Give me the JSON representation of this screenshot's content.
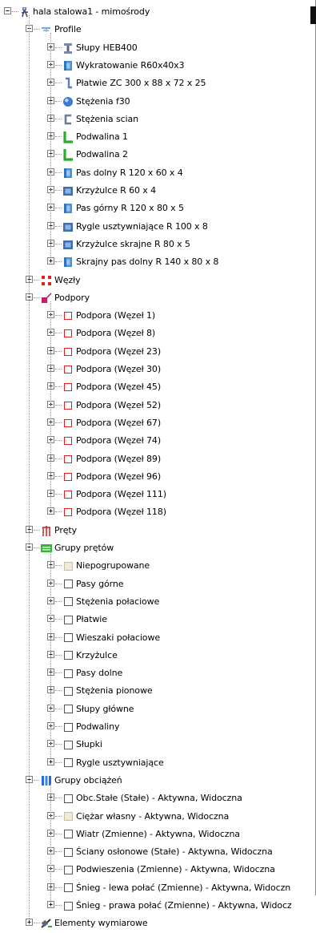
{
  "colors": {
    "accent": "#2a6bd6",
    "support": "#e02020",
    "group": "#2fb52f",
    "tree_line": "#9a9a9a"
  },
  "tree": [
    {
      "level": 0,
      "expander": "minus",
      "icon": "robot-icon",
      "label": "hala stalowa1 - mimośrody",
      "name": "tree-root"
    },
    {
      "level": 1,
      "expander": "minus",
      "icon": "profile-folder-icon",
      "label": "Profile",
      "name": "tree-item-profile"
    },
    {
      "level": 2,
      "expander": "plus",
      "icon": "i-beam-icon",
      "label": "Słupy HEB400",
      "name": "profile-item"
    },
    {
      "level": 2,
      "expander": "plus",
      "icon": "rect-tube-icon",
      "label": "Wykratowanie R60x40x3",
      "name": "profile-item"
    },
    {
      "level": 2,
      "expander": "plus",
      "icon": "z-section-icon",
      "label": "Płatwie ZC 300 x 88 x 72 x 25",
      "name": "profile-item"
    },
    {
      "level": 2,
      "expander": "plus",
      "icon": "round-bar-icon",
      "label": "Stężenia f30",
      "name": "profile-item"
    },
    {
      "level": 2,
      "expander": "plus",
      "icon": "c-section-icon",
      "label": "Stężenia scian",
      "name": "profile-item"
    },
    {
      "level": 2,
      "expander": "plus",
      "icon": "l-section-icon",
      "label": "Podwalina 1",
      "name": "profile-item"
    },
    {
      "level": 2,
      "expander": "plus",
      "icon": "l-section-icon",
      "label": "Podwalina 2",
      "name": "profile-item"
    },
    {
      "level": 2,
      "expander": "plus",
      "icon": "rect-tube-icon",
      "label": "Pas dolny R 120 x 60 x 4",
      "name": "profile-item"
    },
    {
      "level": 2,
      "expander": "plus",
      "icon": "square-tube-icon",
      "label": "Krzyżulce R 60 x 4",
      "name": "profile-item"
    },
    {
      "level": 2,
      "expander": "plus",
      "icon": "rect-tube-icon",
      "label": "Pas górny R 120 x 80 x 5",
      "name": "profile-item"
    },
    {
      "level": 2,
      "expander": "plus",
      "icon": "square-tube-icon",
      "label": "Rygle usztywniające R 100 x 8",
      "name": "profile-item"
    },
    {
      "level": 2,
      "expander": "plus",
      "icon": "square-tube-icon",
      "label": "Krzyżulce skrajne R 80 x 5",
      "name": "profile-item"
    },
    {
      "level": 2,
      "expander": "plus",
      "icon": "rect-tube-icon",
      "label": "Skrajny pas dolny R 140 x 80 x 8",
      "name": "profile-item"
    },
    {
      "level": 1,
      "expander": "plus",
      "icon": "nodes-icon",
      "label": "Węzły",
      "name": "tree-item-nodes"
    },
    {
      "level": 1,
      "expander": "minus",
      "icon": "support-icon",
      "label": "Podpory",
      "name": "tree-item-supports"
    },
    {
      "level": 2,
      "expander": "plus",
      "icon": "red-square-icon",
      "label": "Podpora (Węzeł 1)",
      "name": "support-item"
    },
    {
      "level": 2,
      "expander": "plus",
      "icon": "red-square-icon",
      "label": "Podpora (Węzeł 8)",
      "name": "support-item"
    },
    {
      "level": 2,
      "expander": "plus",
      "icon": "red-square-icon",
      "label": "Podpora (Węzeł 23)",
      "name": "support-item"
    },
    {
      "level": 2,
      "expander": "plus",
      "icon": "red-square-icon",
      "label": "Podpora (Węzeł 30)",
      "name": "support-item"
    },
    {
      "level": 2,
      "expander": "plus",
      "icon": "red-square-icon",
      "label": "Podpora (Węzeł 45)",
      "name": "support-item"
    },
    {
      "level": 2,
      "expander": "plus",
      "icon": "red-square-icon",
      "label": "Podpora (Węzeł 52)",
      "name": "support-item"
    },
    {
      "level": 2,
      "expander": "plus",
      "icon": "red-square-icon",
      "label": "Podpora (Węzeł 67)",
      "name": "support-item"
    },
    {
      "level": 2,
      "expander": "plus",
      "icon": "red-square-icon",
      "label": "Podpora (Węzeł 74)",
      "name": "support-item"
    },
    {
      "level": 2,
      "expander": "plus",
      "icon": "red-square-icon",
      "label": "Podpora (Węzeł 89)",
      "name": "support-item"
    },
    {
      "level": 2,
      "expander": "plus",
      "icon": "red-square-icon",
      "label": "Podpora (Węzeł 96)",
      "name": "support-item"
    },
    {
      "level": 2,
      "expander": "plus",
      "icon": "red-square-icon",
      "label": "Podpora (Węzeł 111)",
      "name": "support-item"
    },
    {
      "level": 2,
      "expander": "plus",
      "icon": "red-square-icon",
      "label": "Podpora (Węzeł 118)",
      "name": "support-item"
    },
    {
      "level": 1,
      "expander": "plus",
      "icon": "bars-icon",
      "label": "Pręty",
      "name": "tree-item-bars"
    },
    {
      "level": 1,
      "expander": "minus",
      "icon": "bar-groups-icon",
      "label": "Grupy prętów",
      "name": "tree-item-bar-groups"
    },
    {
      "level": 2,
      "expander": "plus",
      "icon": "beige-square-icon",
      "label": "Niepogrupowane",
      "name": "bar-group-item"
    },
    {
      "level": 2,
      "expander": "plus",
      "icon": "empty-square-icon",
      "label": "Pasy górne",
      "name": "bar-group-item"
    },
    {
      "level": 2,
      "expander": "plus",
      "icon": "empty-square-icon",
      "label": "Stężenia połaciowe",
      "name": "bar-group-item"
    },
    {
      "level": 2,
      "expander": "plus",
      "icon": "empty-square-icon",
      "label": "Płatwie",
      "name": "bar-group-item"
    },
    {
      "level": 2,
      "expander": "plus",
      "icon": "empty-square-icon",
      "label": "Wieszaki połaciowe",
      "name": "bar-group-item"
    },
    {
      "level": 2,
      "expander": "plus",
      "icon": "empty-square-icon",
      "label": "Krzyżulce",
      "name": "bar-group-item"
    },
    {
      "level": 2,
      "expander": "plus",
      "icon": "empty-square-icon",
      "label": "Pasy dolne",
      "name": "bar-group-item"
    },
    {
      "level": 2,
      "expander": "plus",
      "icon": "empty-square-icon",
      "label": "Stężenia pionowe",
      "name": "bar-group-item"
    },
    {
      "level": 2,
      "expander": "plus",
      "icon": "empty-square-icon",
      "label": "Słupy główne",
      "name": "bar-group-item"
    },
    {
      "level": 2,
      "expander": "plus",
      "icon": "empty-square-icon",
      "label": "Podwaliny",
      "name": "bar-group-item"
    },
    {
      "level": 2,
      "expander": "plus",
      "icon": "empty-square-icon",
      "label": "Słupki",
      "name": "bar-group-item"
    },
    {
      "level": 2,
      "expander": "plus",
      "icon": "empty-square-icon",
      "label": "Rygle usztywniające",
      "name": "bar-group-item"
    },
    {
      "level": 1,
      "expander": "minus",
      "icon": "load-groups-icon",
      "label": "Grupy obciążeń",
      "name": "tree-item-load-groups"
    },
    {
      "level": 2,
      "expander": "plus",
      "icon": "empty-square-icon",
      "label": "Obc.Stałe (Stałe) - Aktywna, Widoczna",
      "name": "load-group-item"
    },
    {
      "level": 2,
      "expander": "plus",
      "icon": "beige-square-icon",
      "label": "Ciężar własny - Aktywna, Widoczna",
      "name": "load-group-item"
    },
    {
      "level": 2,
      "expander": "plus",
      "icon": "empty-square-icon",
      "label": "Wiatr (Zmienne) - Aktywna, Widoczna",
      "name": "load-group-item"
    },
    {
      "level": 2,
      "expander": "plus",
      "icon": "empty-square-icon",
      "label": "Ściany osłonowe (Stałe) - Aktywna, Widoczna",
      "name": "load-group-item"
    },
    {
      "level": 2,
      "expander": "plus",
      "icon": "empty-square-icon",
      "label": "Podwieszenia (Zmienne) - Aktywna, Widoczna",
      "name": "load-group-item"
    },
    {
      "level": 2,
      "expander": "plus",
      "icon": "empty-square-icon",
      "label": "Śnieg - lewa połać (Zmienne) - Aktywna, Widoczn",
      "name": "load-group-item"
    },
    {
      "level": 2,
      "expander": "plus",
      "icon": "empty-square-icon",
      "label": "Śnieg - prawa połać (Zmienne) - Aktywna, Widocz",
      "name": "load-group-item"
    },
    {
      "level": 1,
      "expander": "plus",
      "icon": "dimension-icon",
      "label": "Elementy wymiarowe",
      "name": "tree-item-dimensions"
    }
  ]
}
